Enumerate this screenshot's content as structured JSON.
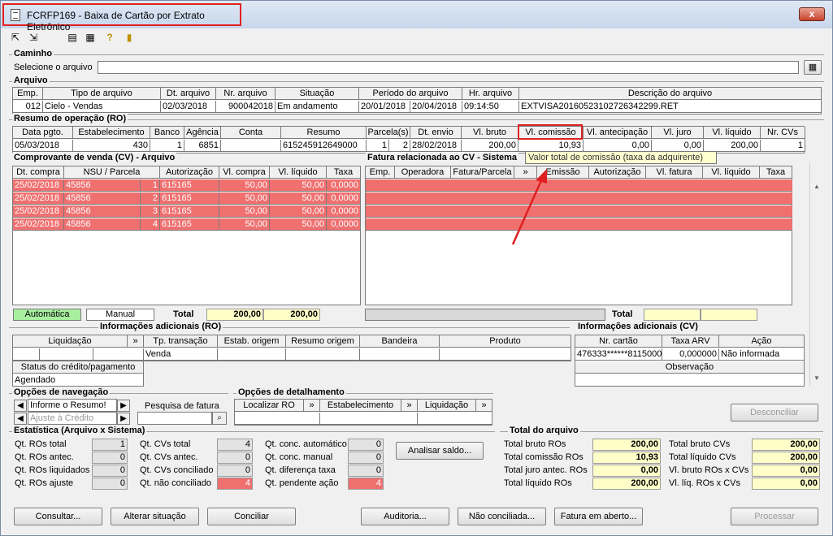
{
  "window": {
    "title": "FCRFP169 - Baixa de Cartão por Extrato Eletrônico",
    "close_label": "x"
  },
  "caminho": {
    "group_title": "Caminho",
    "label": "Selecione o arquivo",
    "value": ""
  },
  "arquivo": {
    "group_title": "Arquivo",
    "headers": [
      "Emp.",
      "Tipo de arquivo",
      "Dt. arquivo",
      "Nr. arquivo",
      "Situação",
      "Período do arquivo",
      "Hr. arquivo",
      "Descrição do arquivo"
    ],
    "row": {
      "emp": "012",
      "tipo": "Cielo - Vendas",
      "dt": "02/03/2018",
      "nr": "900042018",
      "situacao": "Em andamento",
      "periodo_ini": "20/01/2018",
      "periodo_fim": "20/04/2018",
      "hora": "09:14:50",
      "descricao": "EXTVISA20160523102726342299.RET"
    }
  },
  "ro": {
    "group_title": "Resumo de operação (RO)",
    "headers": [
      "Data pgto.",
      "Estabelecimento",
      "Banco",
      "Agência",
      "Conta",
      "Resumo",
      "Parcela(s)",
      "Dt. envio",
      "Vl. bruto",
      "Vl. comissão",
      "Vl. antecipação",
      "Vl. juro",
      "Vl. líquido",
      "Nr. CVs"
    ],
    "row": {
      "data": "05/03/2018",
      "estab": "430",
      "banco": "1",
      "agencia": "6851",
      "conta": "",
      "resumo": "615245912649000",
      "parc1": "1",
      "parc2": "2",
      "envio": "28/02/2018",
      "bruto": "200,00",
      "comissao": "10,93",
      "antecip": "0,00",
      "juro": "0,00",
      "liquido": "200,00",
      "ncvs": "1"
    }
  },
  "tooltip": "Valor total de comissão (taxa da adquirente)",
  "cv": {
    "group_title": "Comprovante de venda (CV) - Arquivo",
    "headers": [
      "Dt. compra",
      "NSU / Parcela",
      "Autorização",
      "Vl. compra",
      "Vl. líquido",
      "Taxa"
    ],
    "rows": [
      {
        "dt": "25/02/2018",
        "nsu": "45856",
        "parc": "1",
        "aut": "615165",
        "vc": "50,00",
        "vl": "50,00",
        "tx": "0,0000"
      },
      {
        "dt": "25/02/2018",
        "nsu": "45856",
        "parc": "2",
        "aut": "615165",
        "vc": "50,00",
        "vl": "50,00",
        "tx": "0,0000"
      },
      {
        "dt": "25/02/2018",
        "nsu": "45856",
        "parc": "3",
        "aut": "615165",
        "vc": "50,00",
        "vl": "50,00",
        "tx": "0,0000"
      },
      {
        "dt": "25/02/2018",
        "nsu": "45856",
        "parc": "4",
        "aut": "615165",
        "vc": "50,00",
        "vl": "50,00",
        "tx": "0,0000"
      }
    ],
    "legend_auto": "Automática",
    "legend_manual": "Manual",
    "total_label": "Total",
    "total_compra": "200,00",
    "total_liquido": "200,00"
  },
  "fatura": {
    "group_title": "Fatura relacionada ao CV - Sistema",
    "headers": [
      "Emp.",
      "Operadora",
      "Fatura/Parcela",
      "»",
      "Emissão",
      "Autorização",
      "Vl. fatura",
      "Vl. líquido",
      "Taxa"
    ],
    "total_label": "Total"
  },
  "info_ro": {
    "group_title": "Informações adicionais (RO)",
    "headers": [
      "Liquidação",
      "»",
      "Tp. transação",
      "Estab. origem",
      "Resumo origem",
      "Bandeira",
      "Produto"
    ],
    "tp_transacao": "Venda",
    "status_label": "Status do crédito/pagamento",
    "status_value": "Agendado"
  },
  "info_cv": {
    "group_title": "Informações adicionais (CV)",
    "headers": [
      "Nr. cartão",
      "Taxa ARV",
      "Ação"
    ],
    "nr_cartao": "476333******8115000",
    "taxa_arv": "0,000000",
    "acao": "Não informada",
    "observacao_label": "Observação"
  },
  "nav": {
    "group_title": "Opções de navegação",
    "resumo_value": "Informe o Resumo!",
    "ajuste_value": "Ajuste à Crédito",
    "pesquisa_label": "Pesquisa de fatura"
  },
  "detalhe": {
    "group_title": "Opções de detalhamento",
    "localizar": "Localizar RO",
    "estabelecimento": "Estabelecimento",
    "liquidacao": "Liquidação"
  },
  "desconciliar": "Desconciliar",
  "estatistica": {
    "group_title": "Estatística (Arquivo x Sistema)",
    "col1": [
      {
        "label": "Qt. ROs total",
        "value": "1"
      },
      {
        "label": "Qt. ROs antec.",
        "value": "0"
      },
      {
        "label": "Qt. ROs liquidados",
        "value": "0"
      },
      {
        "label": "Qt. ROs ajuste",
        "value": "0"
      }
    ],
    "col2": [
      {
        "label": "Qt. CVs total",
        "value": "4"
      },
      {
        "label": "Qt. CVs antec.",
        "value": "0"
      },
      {
        "label": "Qt. CVs conciliado",
        "value": "0"
      },
      {
        "label": "Qt. não conciliado",
        "value": "4"
      }
    ],
    "col3": [
      {
        "label": "Qt. conc. automático",
        "value": "0"
      },
      {
        "label": "Qt. conc. manual",
        "value": "0"
      },
      {
        "label": "Qt. diferença taxa",
        "value": "0"
      },
      {
        "label": "Qt. pendente ação",
        "value": "4"
      }
    ],
    "analisar": "Analisar saldo..."
  },
  "total_arquivo": {
    "group_title": "Total do arquivo",
    "left": [
      {
        "label": "Total bruto ROs",
        "value": "200,00"
      },
      {
        "label": "Total comissão ROs",
        "value": "10,93"
      },
      {
        "label": "Total juro antec. ROs",
        "value": "0,00"
      },
      {
        "label": "Total líquido ROs",
        "value": "200,00"
      }
    ],
    "right": [
      {
        "label": "Total bruto CVs",
        "value": "200,00"
      },
      {
        "label": "Total líquido CVs",
        "value": "200,00"
      },
      {
        "label": "Vl. bruto ROs x CVs",
        "value": "0,00"
      },
      {
        "label": "Vl. líq. ROs x CVs",
        "value": "0,00"
      }
    ]
  },
  "buttons": {
    "consultar": "Consultar...",
    "alterar": "Alterar situação",
    "conciliar": "Conciliar",
    "auditoria": "Auditoria...",
    "nao_conciliada": "Não conciliada...",
    "fatura_aberto": "Fatura em aberto...",
    "processar": "Processar"
  },
  "colors": {
    "red_row": "#f07070",
    "yellow_total": "#fffec8",
    "auto_green": "#a8f0a0",
    "highlight": "#e02020"
  }
}
